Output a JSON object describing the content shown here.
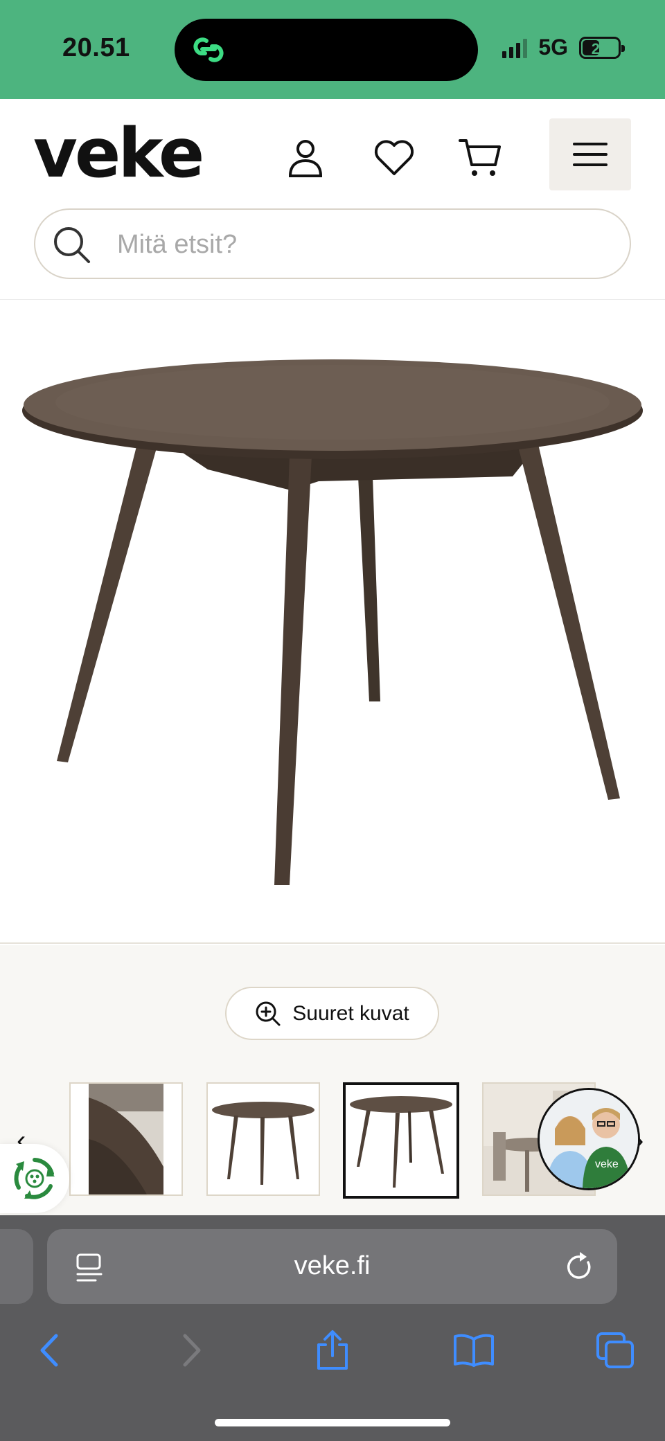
{
  "status_bar": {
    "time": "20.51",
    "network": "5G",
    "battery": "22"
  },
  "header": {
    "logo_text": "veke",
    "icons": [
      "user-icon",
      "heart-icon",
      "cart-icon",
      "menu-icon"
    ]
  },
  "search": {
    "placeholder": "Mitä etsit?"
  },
  "product": {
    "image_icon": "round-dining-table"
  },
  "gallery": {
    "zoom_button_label": "Suuret kuvat",
    "thumbnails": [
      "table-closeup",
      "table-front",
      "table-angled",
      "table-room"
    ],
    "active_thumbnail": 2,
    "prev_arrow": "‹",
    "next_arrow": "›"
  },
  "chat": {
    "shirt_text": "veke"
  },
  "browser": {
    "url": "veke.fi"
  },
  "colors": {
    "status_bar_bg": "#4db47f",
    "wood": "#4e4036",
    "browser_bg": "#5b5b5d",
    "ios_blue": "#3f8dff"
  }
}
